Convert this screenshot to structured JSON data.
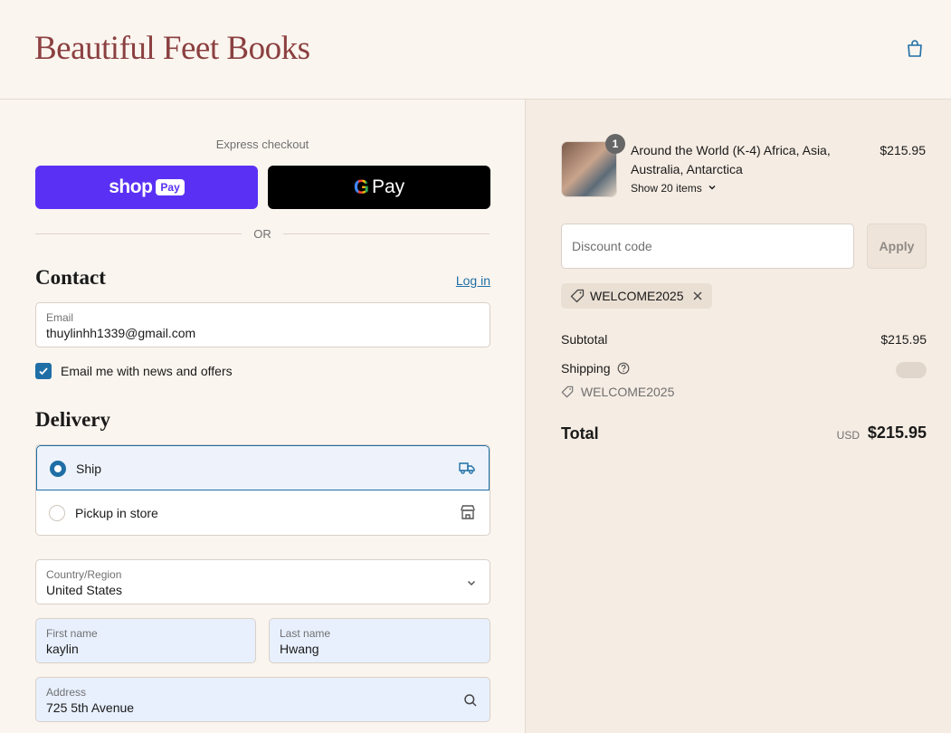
{
  "header": {
    "store_name": "Beautiful Feet Books",
    "cart_icon": "shopping-bag-icon"
  },
  "express": {
    "title": "Express checkout",
    "shop_pay_word": "shop",
    "shop_pay_badge": "Pay",
    "gpay_g": "G",
    "gpay_pay": "Pay",
    "or_text": "OR"
  },
  "contact": {
    "title": "Contact",
    "login_link": "Log in",
    "email_label": "Email",
    "email_value": "thuylinhh1339@gmail.com",
    "newsletter_label": "Email me with news and offers",
    "newsletter_checked": true
  },
  "delivery": {
    "title": "Delivery",
    "options": [
      {
        "label": "Ship",
        "icon": "truck-icon",
        "selected": true
      },
      {
        "label": "Pickup in store",
        "icon": "store-icon",
        "selected": false
      }
    ],
    "country_label": "Country/Region",
    "country_value": "United States",
    "first_name_label": "First name",
    "first_name_value": "kaylin",
    "last_name_label": "Last name",
    "last_name_value": "Hwang",
    "address_label": "Address",
    "address_value": "725 5th Avenue"
  },
  "summary": {
    "item": {
      "title": "Around the World (K-4) Africa, Asia, Australia, Antarctica",
      "quantity": "1",
      "price": "$215.95",
      "show_items": "Show 20 items"
    },
    "discount_placeholder": "Discount code",
    "apply_label": "Apply",
    "applied_code": "WELCOME2025",
    "subtotal_label": "Subtotal",
    "subtotal_value": "$215.95",
    "shipping_label": "Shipping",
    "shipping_code": "WELCOME2025",
    "total_label": "Total",
    "currency": "USD",
    "total_value": "$215.95"
  },
  "colors": {
    "brand": "#8b4040",
    "accent": "#1f6fa6",
    "shop_pay": "#5a31f4"
  }
}
